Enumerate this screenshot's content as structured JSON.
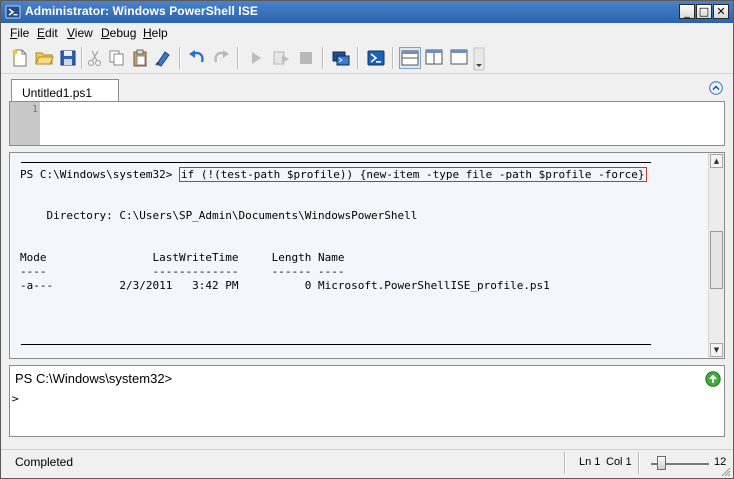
{
  "window": {
    "title": "Administrator: Windows PowerShell ISE",
    "controls": {
      "minimize": "_",
      "maximize": "□",
      "close": "✕"
    }
  },
  "menu": [
    {
      "mnemonic": "F",
      "rest": "ile"
    },
    {
      "mnemonic": "E",
      "rest": "dit"
    },
    {
      "mnemonic": "V",
      "rest": "iew"
    },
    {
      "mnemonic": "D",
      "rest": "ebug"
    },
    {
      "mnemonic": "H",
      "rest": "elp"
    }
  ],
  "toolbar": {
    "icons": [
      "new-file-icon",
      "open-folder-icon",
      "save-icon",
      "cut-icon",
      "copy-icon",
      "paste-icon",
      "clear-console-icon",
      "undo-icon",
      "redo-icon",
      "run-script-icon",
      "run-selection-icon",
      "stop-icon",
      "remote-powershell-icon",
      "powershell-icon",
      "layout-top-icon",
      "layout-right-icon",
      "layout-max-icon"
    ]
  },
  "tabs": [
    {
      "label": "Untitled1.ps1"
    }
  ],
  "editor": {
    "line_number": "1"
  },
  "output": {
    "prompt": "PS C:\\Windows\\system32>",
    "command": "if (!(test-path $profile)) {new-item -type file -path $profile -force}",
    "directory_line": "    Directory: C:\\Users\\SP_Admin\\Documents\\WindowsPowerShell",
    "header_line": "Mode                LastWriteTime     Length Name",
    "dash_line": "----                -------------     ------ ----",
    "row_line": "-a---          2/3/2011   3:42 PM          0 Microsoft.PowerShellISE_profile.ps1"
  },
  "command_pane": {
    "prompt": "PS C:\\Windows\\system32>",
    "caret": ">"
  },
  "status": {
    "text": "Completed",
    "ln": "Ln 1",
    "col": "Col 1",
    "zoom": "12",
    "zoom_fraction": 0.18
  },
  "colors": {
    "titlebar": "#2b62ae",
    "output_background": "#f4f6fb",
    "command_highlight": "#c0392b",
    "gutter": "#c8c8c8",
    "line_number": "#2b91af"
  }
}
